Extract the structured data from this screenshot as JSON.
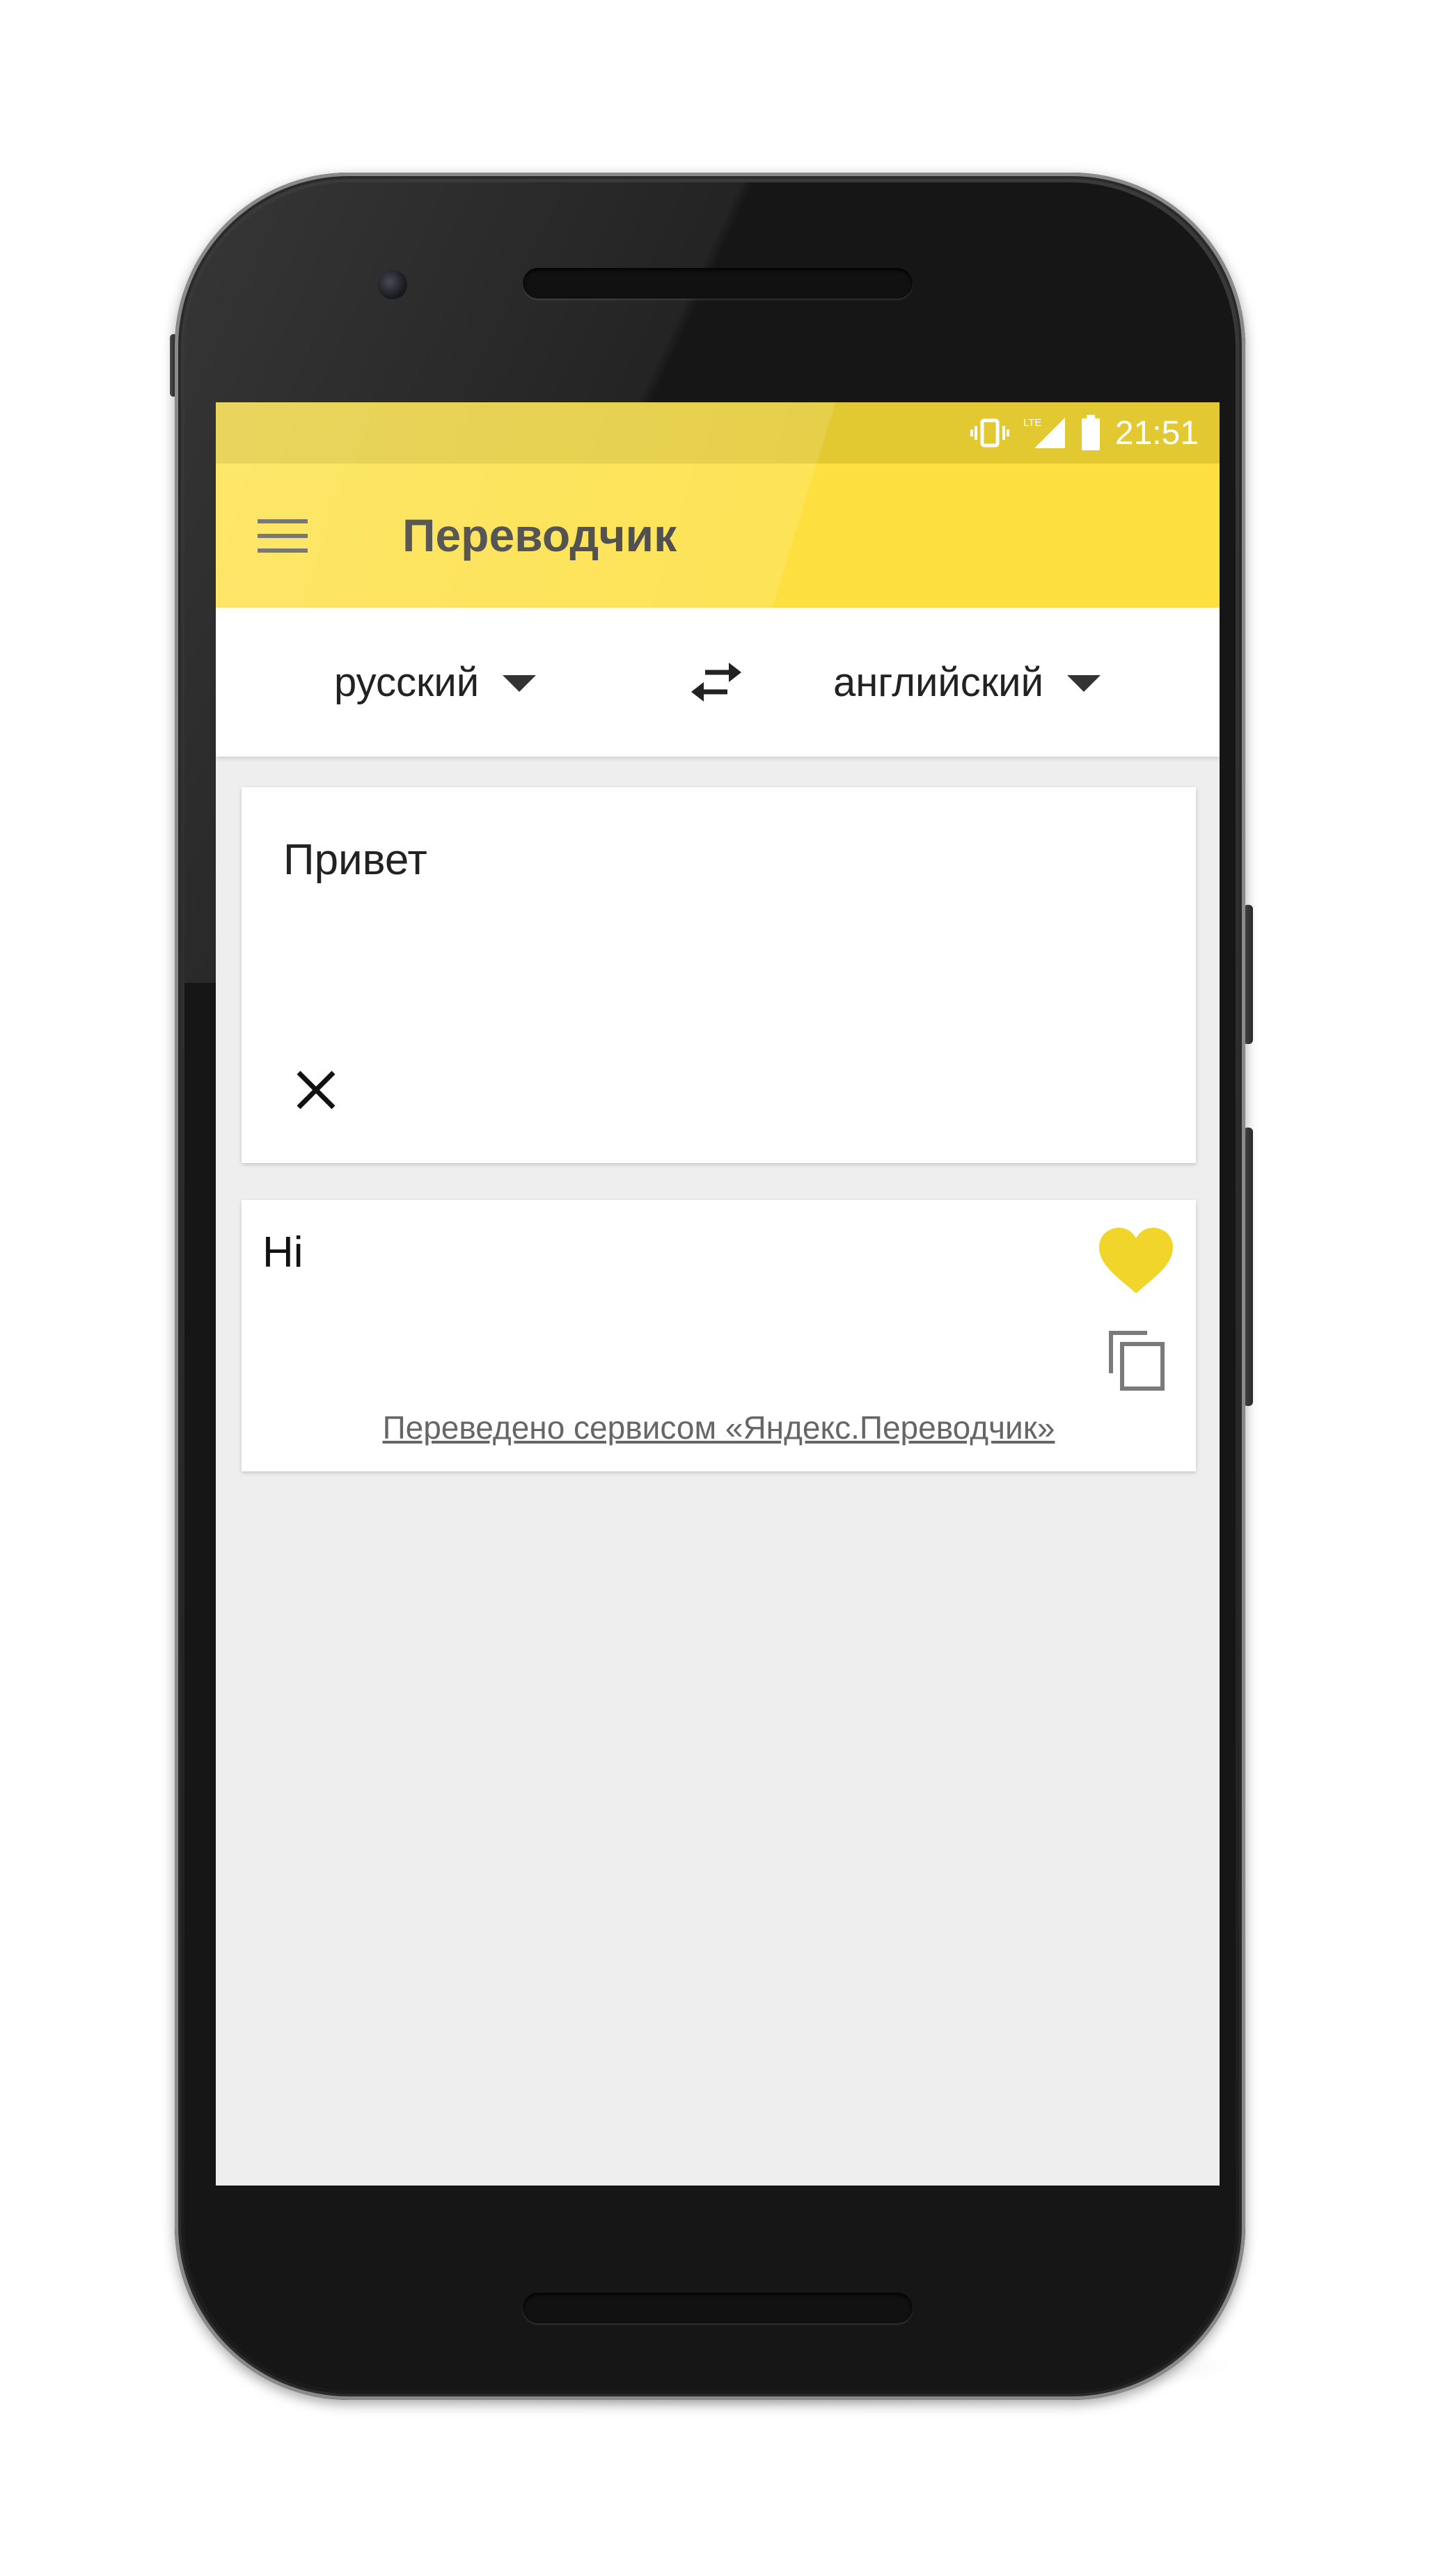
{
  "status_bar": {
    "time": "21:51",
    "icons": [
      "vibrate-icon",
      "lte-signal-icon",
      "battery-icon"
    ],
    "network_label": "LTE"
  },
  "app_bar": {
    "title": "Переводчик",
    "menu_icon": "menu-icon"
  },
  "language_bar": {
    "source_language": "русский",
    "target_language": "английский",
    "swap_icon": "swap-icon"
  },
  "input_card": {
    "value": "Привет",
    "clear_icon": "close-icon"
  },
  "output_card": {
    "translation": "Hi",
    "favorite_icon": "heart-icon",
    "copy_icon": "copy-icon",
    "attribution": "Переведено сервисом «Яндекс.Переводчик»"
  },
  "colors": {
    "app_bar": "#fddf3f",
    "status_bar": "#e3c931",
    "favorite": "#f2d52a",
    "background": "#eeeeee"
  }
}
